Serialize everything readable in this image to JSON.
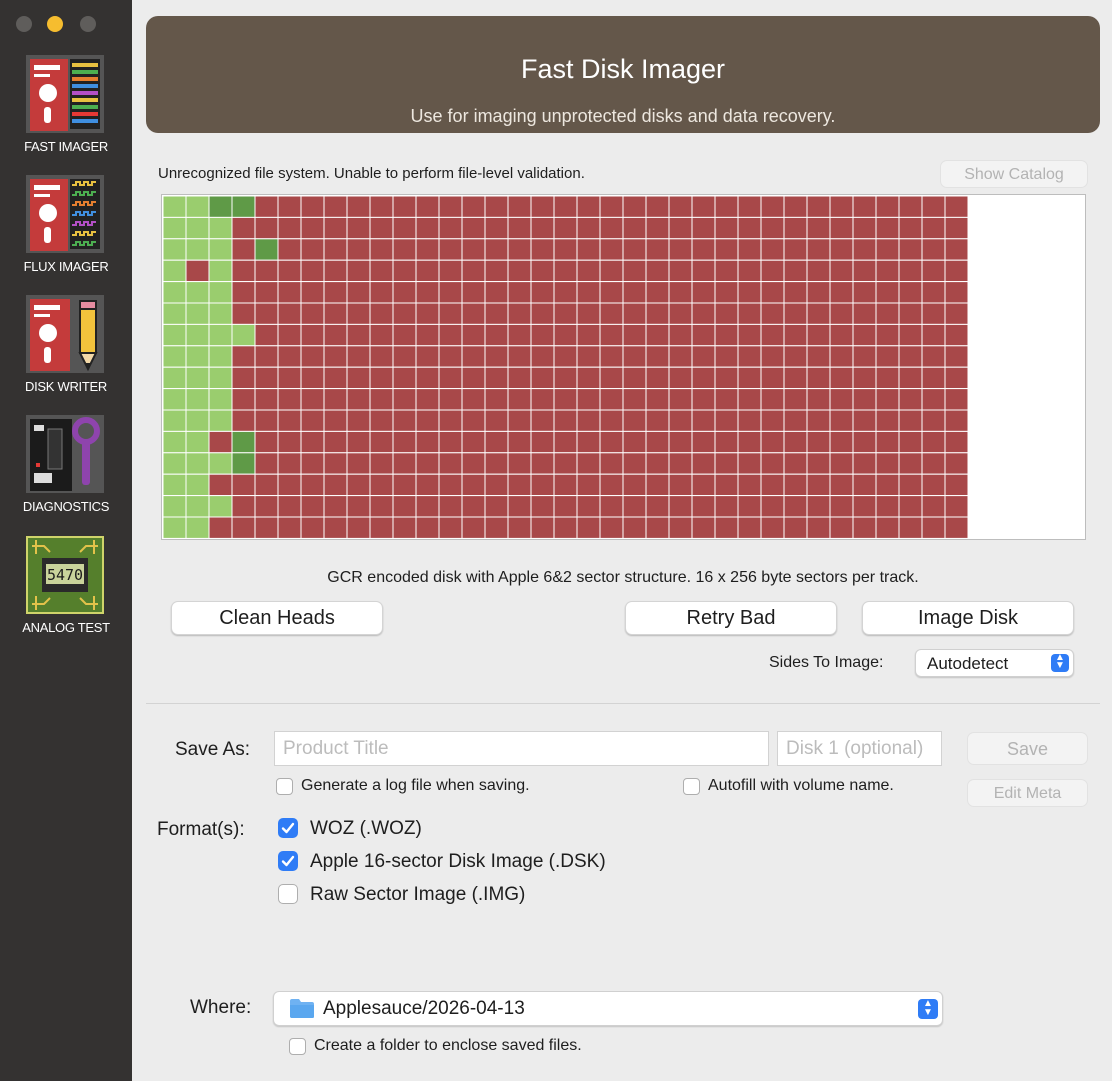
{
  "window": {
    "controls": [
      "close-icon",
      "minimize-icon",
      "zoom-icon"
    ],
    "accent_color": "#2f7cf6"
  },
  "sidebar": {
    "items": [
      {
        "label": "FAST IMAGER",
        "icon": "fast-imager-icon"
      },
      {
        "label": "FLUX IMAGER",
        "icon": "flux-imager-icon"
      },
      {
        "label": "DISK WRITER",
        "icon": "disk-writer-icon"
      },
      {
        "label": "DIAGNOSTICS",
        "icon": "diagnostics-icon"
      },
      {
        "label": "ANALOG TEST",
        "icon": "analog-test-icon",
        "chip_text": "5470"
      }
    ]
  },
  "header": {
    "title": "Fast Disk Imager",
    "subtitle": "Use for imaging unprotected disks and data recovery.",
    "background": "#64574a"
  },
  "status": {
    "message": "Unrecognized file system. Unable to perform file-level validation.",
    "show_catalog_label": "Show Catalog"
  },
  "sector_grid": {
    "tracks": 35,
    "sectors_per_track": 16,
    "colors": {
      "good": "#9acd6e",
      "verified": "#5f9a47",
      "bad": "#a84849",
      "empty": "#ffffff"
    },
    "legend": "g = good, v = verified, b = bad; rows are sectors, columns are tracks",
    "rows": [
      "ggvvbbbbbbbbbbbbbbbbbbbbbbbbbbbbbbb",
      "gggbbbbbbbbbbbbbbbbbbbbbbbbbbbbbbbb",
      "gggbvbbbbbbbbbbbbbbbbbbbbbbbbbbbbbb",
      "gbgbbbbbbbbbbbbbbbbbbbbbbbbbbbbbbbb",
      "gggbbbbbbbbbbbbbbbbbbbbbbbbbbbbbbbb",
      "gggbbbbbbbbbbbbbbbbbbbbbbbbbbbbbbbb",
      "ggggbbbbbbbbbbbbbbbbbbbbbbbbbbbbbbb",
      "gggbbbbbbbbbbbbbbbbbbbbbbbbbbbbbbbb",
      "gggbbbbbbbbbbbbbbbbbbbbbbbbbbbbbbbb",
      "gggbbbbbbbbbbbbbbbbbbbbbbbbbbbbbbbb",
      "gggbbbbbbbbbbbbbbbbbbbbbbbbbbbbbbbb",
      "ggbvbbbbbbbbbbbbbbbbbbbbbbbbbbbbbbb",
      "gggvbbbbbbbbbbbbbbbbbbbbbbbbbbbbbbb",
      "ggbbbbbbbbbbbbbbbbbbbbbbbbbbbbbbbbb",
      "gggbbbbbbbbbbbbbbbbbbbbbbbbbbbbbbbb",
      "ggbbbbbbbbbbbbbbbbbbbbbbbbbbbbbbbbb"
    ]
  },
  "disk_description": "GCR encoded disk with Apple 6&2 sector structure. 16 x 256 byte sectors per track.",
  "actions": {
    "clean_heads": "Clean Heads",
    "retry_bad": "Retry Bad",
    "image_disk": "Image Disk"
  },
  "sides": {
    "label": "Sides To Image:",
    "value": "Autodetect"
  },
  "save": {
    "label": "Save As:",
    "title_placeholder": "Product Title",
    "title_value": "",
    "disk_placeholder": "Disk 1 (optional)",
    "disk_value": "",
    "save_button": "Save",
    "edit_meta_button": "Edit Meta",
    "log_label": "Generate a log file when saving.",
    "log_checked": false,
    "autofill_label": "Autofill with volume name.",
    "autofill_checked": false
  },
  "formats": {
    "label": "Format(s):",
    "options": [
      {
        "label": "WOZ (.WOZ)",
        "checked": true
      },
      {
        "label": "Apple 16-sector Disk Image (.DSK)",
        "checked": true
      },
      {
        "label": "Raw Sector Image (.IMG)",
        "checked": false
      }
    ]
  },
  "where": {
    "label": "Where:",
    "value": "Applesauce/2026-04-13",
    "icon": "folder-icon",
    "enclose_label": "Create a folder to enclose saved files.",
    "enclose_checked": false
  }
}
